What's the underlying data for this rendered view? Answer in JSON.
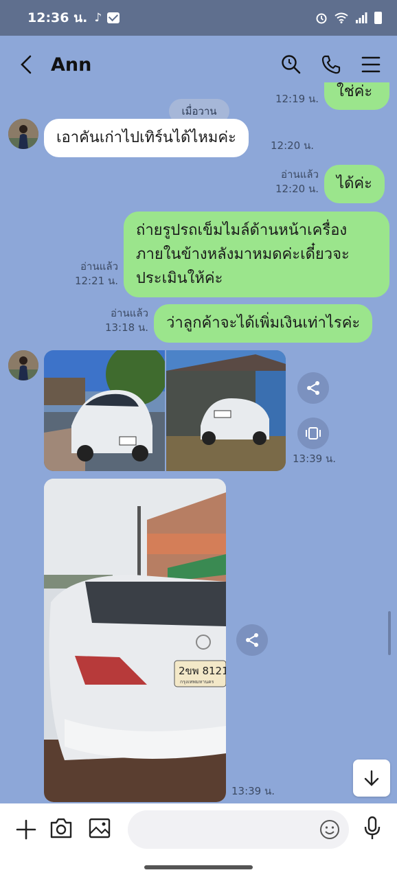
{
  "status_bar": {
    "time": "12:36 น.",
    "tiktok_icon": "tiktok-icon",
    "mail_icon": "mail-icon",
    "right_icons": [
      "alarm-icon",
      "wifi-icon",
      "signal-icon",
      "battery-icon"
    ]
  },
  "header": {
    "title": "Ann",
    "icons": [
      "back-icon",
      "search-icon",
      "phone-icon",
      "menu-icon"
    ]
  },
  "date_label": "เมื่อวาน",
  "messages": [
    {
      "side": "out",
      "text": "ใช่ค่ะ",
      "time": "12:19 น.",
      "read": ""
    },
    {
      "side": "in",
      "text": "เอาคันเก่าไปเทิร์นได้ไหมค่ะ",
      "time": "12:20 น."
    },
    {
      "side": "out",
      "text": "ได้ค่ะ",
      "time": "12:20 น.",
      "read": "อ่านแล้ว"
    },
    {
      "side": "out",
      "lines": [
        "ถ่ายรูปรถเข็มไมล์ด้านหน้าเครื่อง",
        "ภายในข้างหลังมาหมดค่ะเดี๋ยวจะ",
        "ประเมินให้ค่ะ"
      ],
      "time": "12:21 น.",
      "read": "อ่านแล้ว"
    },
    {
      "side": "out",
      "text": "ว่าลูกค้าจะได้เพิ่มเงินเท่าไรค่ะ",
      "time": "13:18 น.",
      "read": "อ่านแล้ว"
    },
    {
      "side": "in",
      "type": "photos",
      "count": 2,
      "time": "13:39 น."
    },
    {
      "side": "in",
      "type": "photo",
      "plate": "2ขพ 8121",
      "plate_sub": "กรุงเทพมหานคร",
      "time": "13:39 น."
    }
  ],
  "input": {
    "placeholder": ""
  },
  "colors": {
    "background": "#8da7d8",
    "outgoing": "#9be58c",
    "incoming": "#ffffff"
  }
}
